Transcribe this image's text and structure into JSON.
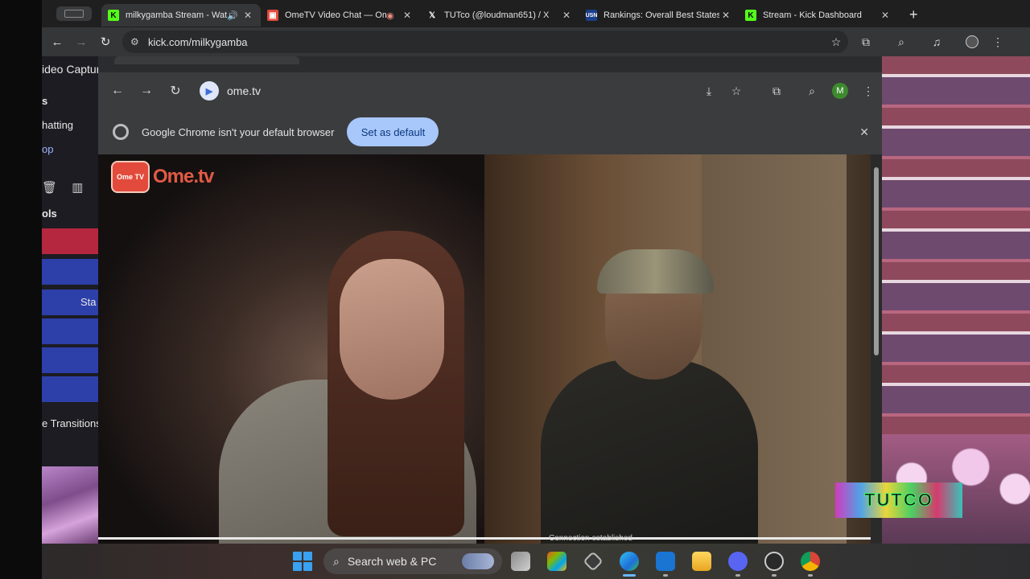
{
  "outer_browser": {
    "tabs": [
      {
        "title": "milkygamba Stream - Wat",
        "favicon": "kick-icon",
        "active": true
      },
      {
        "title": "OmeTV Video Chat — Om",
        "favicon": "ometv-icon",
        "active": false
      },
      {
        "title": "TUTco (@loudman651) / X",
        "favicon": "x-icon",
        "active": false
      },
      {
        "title": "Rankings: Overall Best States",
        "favicon": "usnews-icon",
        "active": false
      },
      {
        "title": "Stream - Kick Dashboard",
        "favicon": "kick-icon",
        "active": false
      }
    ],
    "url": "kick.com/milkygamba"
  },
  "obs_panel": {
    "labels": [
      "ideo Captur",
      "s",
      "hatting",
      "op",
      "ols",
      "Sta",
      "e Transitions"
    ]
  },
  "inner_browser": {
    "url": "ome.tv",
    "profile_initial": "M",
    "infobar": {
      "message": "Google Chrome isn't your default browser",
      "button": "Set as default"
    },
    "status": "Connection established"
  },
  "ometv_logo": {
    "badge": "Ome TV",
    "wordmark": "Ome.tv"
  },
  "overlay_logo": "TUTCO",
  "taskbar": {
    "search_placeholder": "Search web & PC",
    "apps": [
      "start-icon",
      "task-view-icon",
      "store-icon",
      "app-icon",
      "edge-icon",
      "outlook-icon",
      "file-explorer-icon",
      "discord-icon",
      "obs-icon",
      "chrome-icon"
    ]
  },
  "colors": {
    "kick_green": "#53fc18",
    "infobar_button": "#a8c7fa",
    "obs_blue": "#2d3fa8",
    "obs_red": "#b4273f"
  }
}
